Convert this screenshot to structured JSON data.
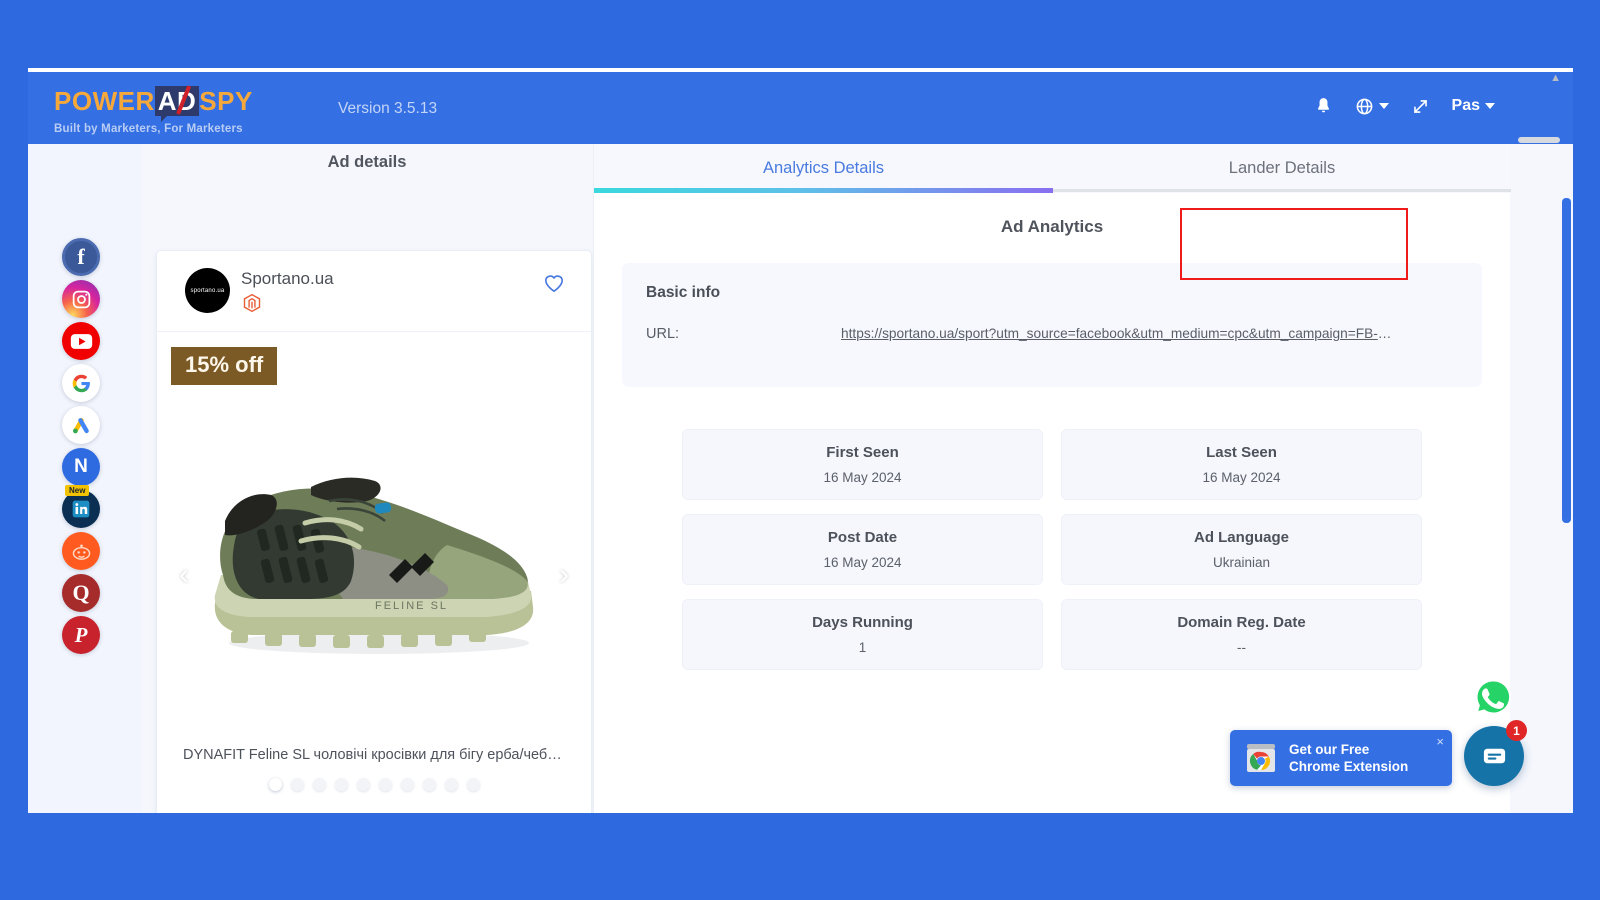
{
  "header": {
    "logo": {
      "part1": "POWER",
      "part2": "AD",
      "part3": "SPY"
    },
    "tagline": "Built by Marketers, For Marketers",
    "version": "Version 3.5.13",
    "user": "Pas",
    "icons": [
      "bell-icon",
      "globe-icon",
      "expand-icon"
    ]
  },
  "sidebar": {
    "items": [
      {
        "name": "facebook",
        "label": "f",
        "color": "#3b5998"
      },
      {
        "name": "instagram",
        "label": "",
        "color": "#d6249f"
      },
      {
        "name": "youtube",
        "label": "",
        "color": "#ff0000"
      },
      {
        "name": "google",
        "label": "G",
        "color": "#ffffff"
      },
      {
        "name": "google-ads",
        "label": "",
        "color": "#ffffff"
      },
      {
        "name": "native",
        "label": "N",
        "color": "#2f6be0"
      },
      {
        "name": "linkedin",
        "label": "in",
        "color": "#0a66c2",
        "badge": "New"
      },
      {
        "name": "reddit",
        "label": "",
        "color": "#ff4500"
      },
      {
        "name": "quora",
        "label": "Q",
        "color": "#a62c2c"
      },
      {
        "name": "pinterest",
        "label": "P",
        "color": "#c8232c"
      }
    ],
    "expand_label": "▾"
  },
  "ad_panel": {
    "title": "Ad details",
    "advertiser": "Sportano.ua",
    "avatar_text": "sportano.ua",
    "platform": "magento-icon",
    "discount_badge": "15% off",
    "caption": "DYNAFIT Feline SL чоловічі кросівки для бігу ерба/чебр...",
    "prev_arrow": "‹",
    "next_arrow": "›",
    "dot_count": 10,
    "active_dot": 0,
    "shoe_alt": "DYNAFIT Feline SL trail running shoe"
  },
  "analytics": {
    "tabs": [
      {
        "label": "Analytics Details",
        "active": true
      },
      {
        "label": "Lander Details",
        "active": false
      }
    ],
    "section_title": "Ad Analytics",
    "basic_info": {
      "label": "Basic info",
      "url_key": "URL:",
      "url_value": "https://sportano.ua/sport?utm_source=facebook&utm_medium=cpc&utm_campaign=FB-UA ..."
    },
    "stats": [
      {
        "label": "First Seen",
        "value": "16 May 2024"
      },
      {
        "label": "Last Seen",
        "value": "16 May 2024"
      },
      {
        "label": "Post Date",
        "value": "16 May 2024"
      },
      {
        "label": "Ad Language",
        "value": "Ukrainian"
      },
      {
        "label": "Days Running",
        "value": "1"
      },
      {
        "label": "Domain Reg. Date",
        "value": "--"
      }
    ]
  },
  "widgets": {
    "chrome_ext_line1": "Get our Free",
    "chrome_ext_line2": "Chrome Extension",
    "chrome_ext_close": "×",
    "chat_badge": "1"
  },
  "colors": {
    "brand_blue": "#3470e4",
    "accent_orange": "#f6a83a",
    "tab_active": "#4a7ae0",
    "highlight_red": "#ef1b1b"
  }
}
